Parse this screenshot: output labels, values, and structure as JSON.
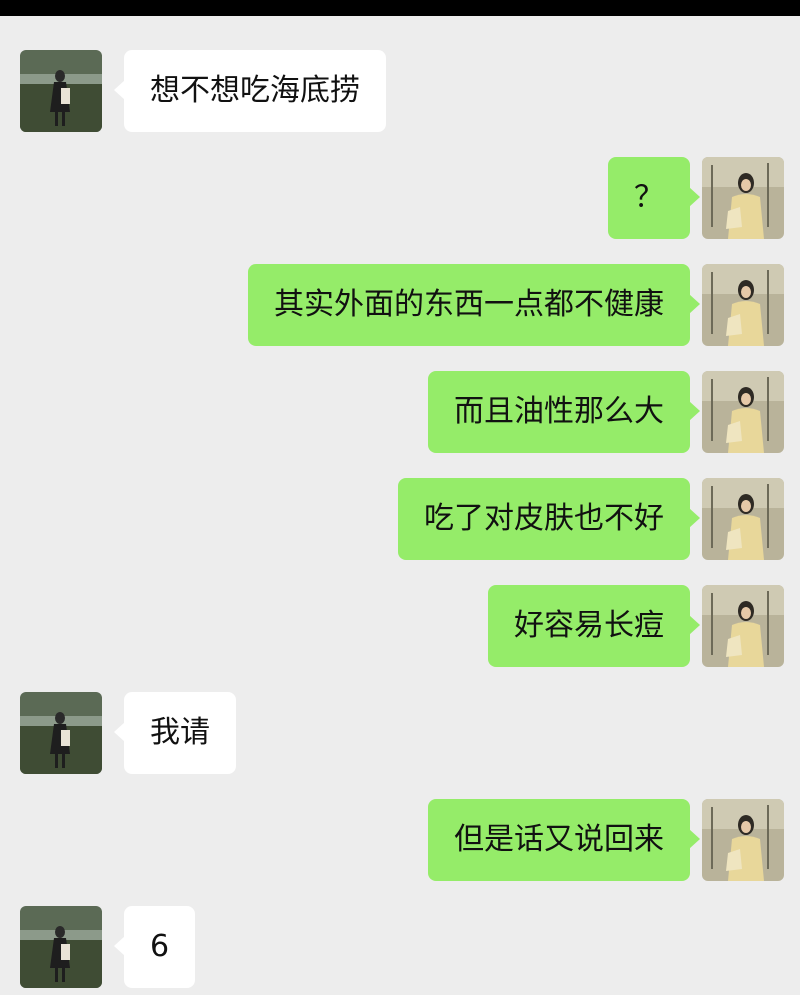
{
  "conversation": {
    "messages": [
      {
        "side": "left",
        "text": "想不想吃海底捞"
      },
      {
        "side": "right",
        "text": "？"
      },
      {
        "side": "right",
        "text": "其实外面的东西一点都不健康"
      },
      {
        "side": "right",
        "text": "而且油性那么大"
      },
      {
        "side": "right",
        "text": "吃了对皮肤也不好"
      },
      {
        "side": "right",
        "text": "好容易长痘"
      },
      {
        "side": "left",
        "text": "我请"
      },
      {
        "side": "right",
        "text": "但是话又说回来"
      },
      {
        "side": "left",
        "text": "6"
      }
    ]
  },
  "avatars": {
    "left_icon": "avatar-girl-in-field-photo",
    "right_icon": "avatar-girl-yellow-coat-photo"
  },
  "colors": {
    "background": "#ededed",
    "sent_bubble": "#95ec69",
    "received_bubble": "#ffffff"
  }
}
